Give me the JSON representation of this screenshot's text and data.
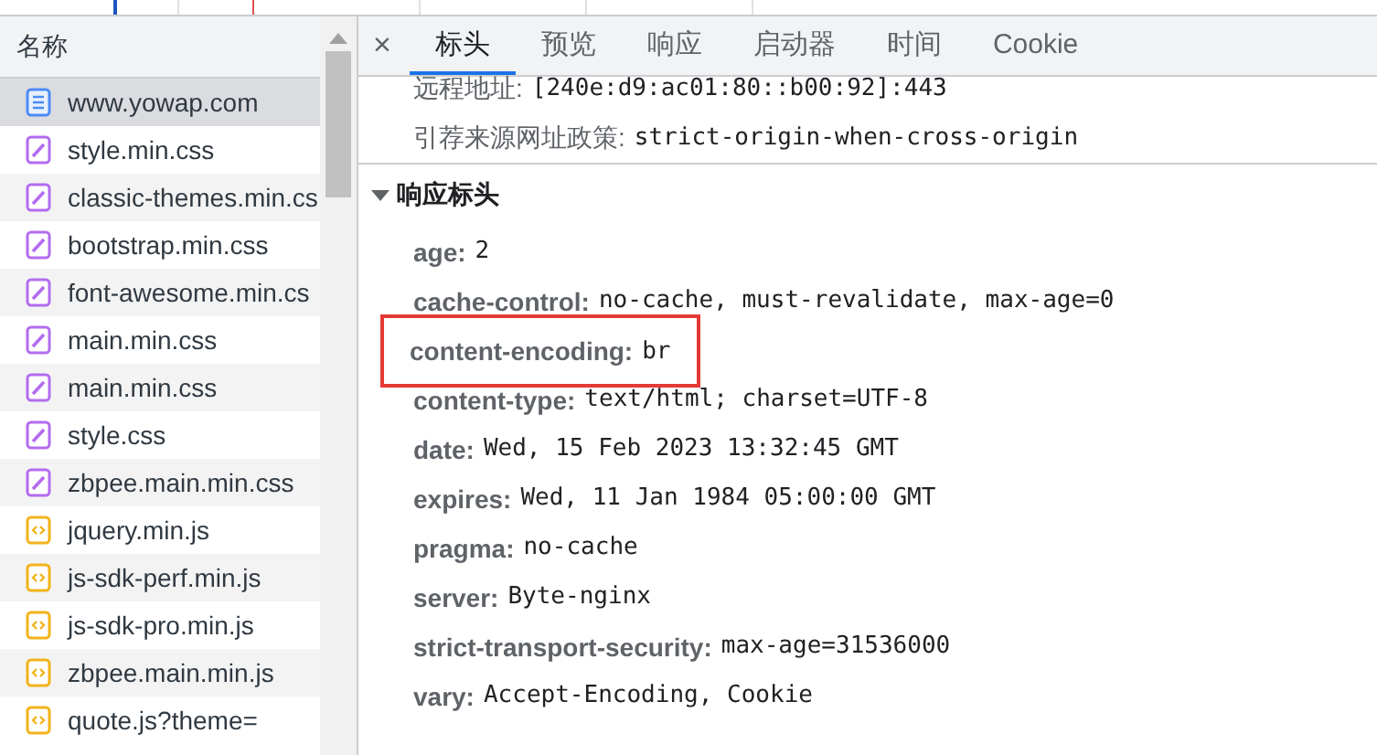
{
  "request_list": {
    "column_header": "名称",
    "items": [
      {
        "kind": "document",
        "name": "www.yowap.com",
        "selected": true
      },
      {
        "kind": "stylesheet",
        "name": "style.min.css",
        "selected": false
      },
      {
        "kind": "stylesheet",
        "name": "classic-themes.min.cs",
        "selected": false
      },
      {
        "kind": "stylesheet",
        "name": "bootstrap.min.css",
        "selected": false
      },
      {
        "kind": "stylesheet",
        "name": "font-awesome.min.cs",
        "selected": false
      },
      {
        "kind": "stylesheet",
        "name": "main.min.css",
        "selected": false
      },
      {
        "kind": "stylesheet",
        "name": "main.min.css",
        "selected": false
      },
      {
        "kind": "stylesheet",
        "name": "style.css",
        "selected": false
      },
      {
        "kind": "stylesheet",
        "name": "zbpee.main.min.css",
        "selected": false
      },
      {
        "kind": "script",
        "name": "jquery.min.js",
        "selected": false
      },
      {
        "kind": "script",
        "name": "js-sdk-perf.min.js",
        "selected": false
      },
      {
        "kind": "script",
        "name": "js-sdk-pro.min.js",
        "selected": false
      },
      {
        "kind": "script",
        "name": "zbpee.main.min.js",
        "selected": false
      },
      {
        "kind": "script",
        "name": "quote.js?theme=",
        "selected": false
      }
    ]
  },
  "details": {
    "close": "×",
    "tabs": [
      {
        "label": "标头",
        "selected": true
      },
      {
        "label": "预览",
        "selected": false
      },
      {
        "label": "响应",
        "selected": false
      },
      {
        "label": "启动器",
        "selected": false
      },
      {
        "label": "时间",
        "selected": false
      },
      {
        "label": "Cookie",
        "selected": false
      }
    ],
    "general": [
      {
        "name": "远程地址:",
        "value": "[240e:d9:ac01:80::b00:92]:443"
      },
      {
        "name": "引荐来源网址政策:",
        "value": "strict-origin-when-cross-origin"
      }
    ],
    "response_headers": {
      "title": "响应标头",
      "expanded": true,
      "items": [
        {
          "name": "age:",
          "value": "2",
          "highlighted": false
        },
        {
          "name": "cache-control:",
          "value": "no-cache, must-revalidate, max-age=0",
          "highlighted": false
        },
        {
          "name": "content-encoding:",
          "value": "br",
          "highlighted": true
        },
        {
          "name": "content-type:",
          "value": "text/html; charset=UTF-8",
          "highlighted": false
        },
        {
          "name": "date:",
          "value": "Wed, 15 Feb 2023 13:32:45 GMT",
          "highlighted": false
        },
        {
          "name": "expires:",
          "value": "Wed, 11 Jan 1984 05:00:00 GMT",
          "highlighted": false
        },
        {
          "name": "pragma:",
          "value": "no-cache",
          "highlighted": false
        },
        {
          "name": "server:",
          "value": "Byte-nginx",
          "highlighted": false
        },
        {
          "name": "strict-transport-security:",
          "value": "max-age=31536000",
          "highlighted": false
        },
        {
          "name": "vary:",
          "value": "Accept-Encoding, Cookie",
          "highlighted": false
        }
      ]
    }
  }
}
